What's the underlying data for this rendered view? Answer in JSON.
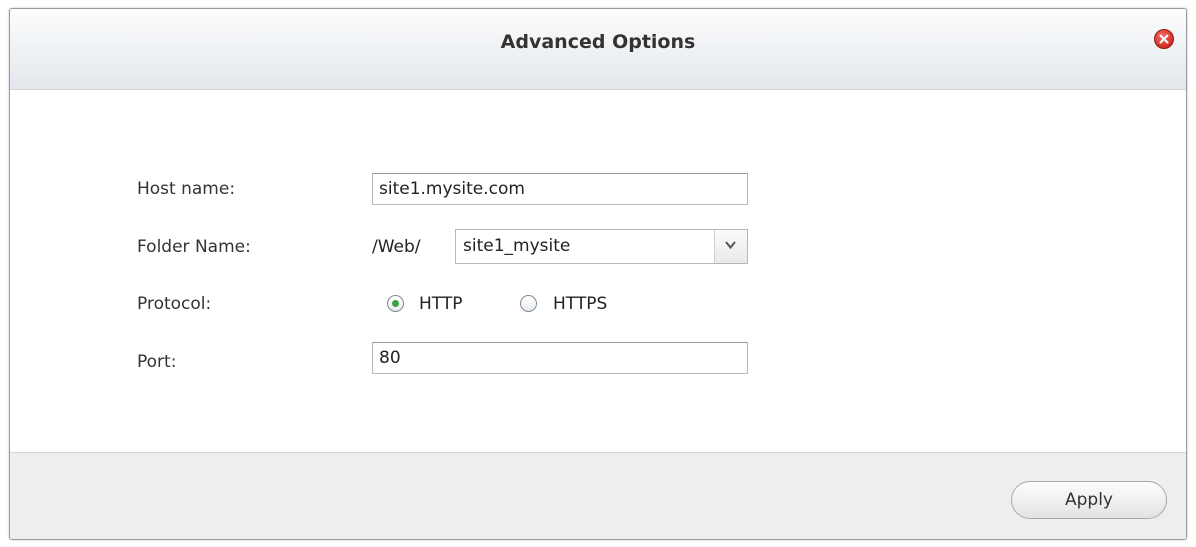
{
  "dialog": {
    "title": "Advanced Options",
    "close_icon": "close-icon"
  },
  "form": {
    "host_name": {
      "label": "Host name:",
      "value": "site1.mysite.com"
    },
    "folder_name": {
      "label": "Folder Name:",
      "prefix": "/Web/",
      "selected": "site1_mysite",
      "arrow_icon": "chevron-down-icon"
    },
    "protocol": {
      "label": "Protocol:",
      "options": [
        {
          "label": "HTTP",
          "checked": true
        },
        {
          "label": "HTTPS",
          "checked": false
        }
      ]
    },
    "port": {
      "label": "Port:",
      "value": "80"
    }
  },
  "footer": {
    "apply_label": "Apply"
  },
  "colors": {
    "radio_checked": "#3aa043",
    "close_button": "#d8352c"
  }
}
